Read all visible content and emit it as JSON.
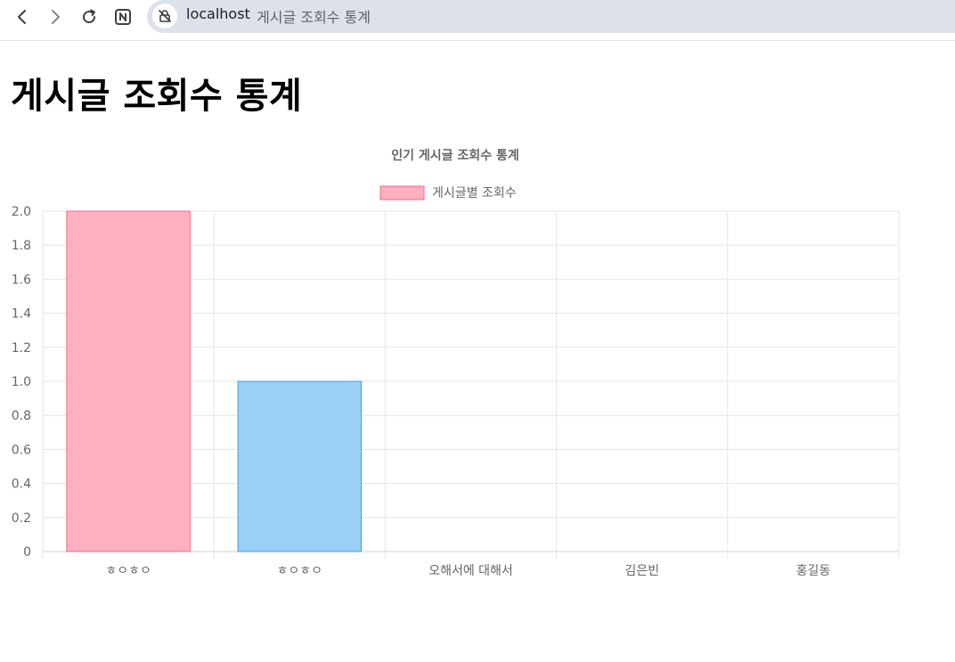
{
  "browser": {
    "url_host": "localhost",
    "url_title": "게시글 조회수 통계",
    "icons": [
      "back-icon",
      "forward-icon",
      "reload-icon",
      "extension-n-icon",
      "site-info-icon"
    ]
  },
  "page": {
    "title": "게시글 조회수 통계"
  },
  "chart_data": {
    "type": "bar",
    "title": "인기 게시글 조회수 통계",
    "categories": [
      "ㅎㅇㅎㅇ",
      "ㅎㅇㅎㅇ",
      "오해서에 대해서",
      "김은빈",
      "홍길동"
    ],
    "series": [
      {
        "name": "게시글별 조회수",
        "values": [
          2,
          1,
          0,
          0,
          0
        ],
        "colors": [
          "#ffb1c1",
          "#9ad0f5",
          "#ffcf9f",
          "#a5dfdf",
          "#ccb2ff"
        ],
        "border_colors": [
          "#ff6384",
          "#36a2eb",
          "#ff9f40",
          "#4bc0c0",
          "#9966ff"
        ]
      }
    ],
    "ylim": [
      0,
      2
    ],
    "y_ticks": [
      "0",
      "0.2",
      "0.4",
      "0.6",
      "0.8",
      "1.0",
      "1.2",
      "1.4",
      "1.6",
      "1.8",
      "2.0"
    ],
    "legend_position": "top",
    "grid": true,
    "xlabel": "",
    "ylabel": ""
  }
}
